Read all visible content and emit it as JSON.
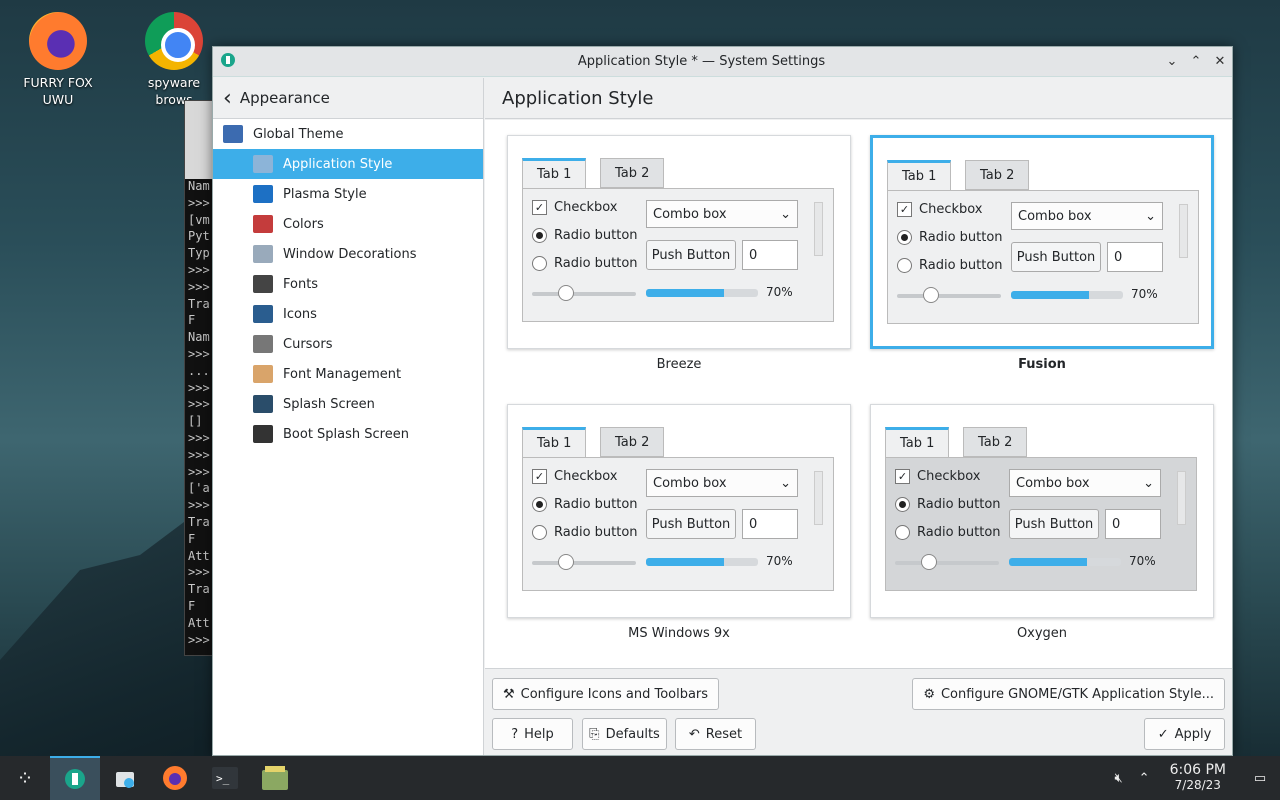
{
  "desktop": {
    "icons": [
      {
        "label": "FURRY FOX UWU"
      },
      {
        "label_line1": "spyware",
        "label_line2": "brows"
      }
    ]
  },
  "terminal": {
    "lines": [
      "Nam",
      ">>>",
      "[vm",
      "Pyt",
      "Typ",
      ">>>",
      ">>>",
      "Tra",
      "  F",
      "Nam",
      ">>>",
      "...",
      ">>>",
      ">>>",
      "[]",
      ">>>",
      ">>>",
      ">>>",
      "['a",
      ">>>",
      "Tra",
      "  F",
      "Att",
      ">>>",
      "Tra",
      "  F",
      "Att",
      ">>>"
    ]
  },
  "window": {
    "title": "Application Style * — System Settings"
  },
  "sidebar": {
    "header": "Appearance",
    "items": [
      {
        "label": "Global Theme",
        "color": "#3c6bb0"
      },
      {
        "label": "Application Style",
        "color": "#8cb4d8"
      },
      {
        "label": "Plasma Style",
        "color": "#1d70c4"
      },
      {
        "label": "Colors",
        "color": "#c43c3c"
      },
      {
        "label": "Window Decorations",
        "color": "#9ab"
      },
      {
        "label": "Fonts",
        "color": "#444"
      },
      {
        "label": "Icons",
        "color": "#2a5d8f"
      },
      {
        "label": "Cursors",
        "color": "#777"
      },
      {
        "label": "Font Management",
        "color": "#d9a46a"
      },
      {
        "label": "Splash Screen",
        "color": "#2a4d6a"
      },
      {
        "label": "Boot Splash Screen",
        "color": "#333"
      }
    ]
  },
  "main": {
    "title": "Application Style",
    "styles": [
      {
        "caption": "Breeze",
        "tab1": "Tab 1",
        "tab2": "Tab 2",
        "checkbox": "Checkbox",
        "radio1": "Radio button",
        "radio2": "Radio button",
        "combo": "Combo box",
        "push": "Push Button",
        "spin": "0",
        "progress_text": "70%",
        "progress": 0.7
      },
      {
        "caption": "Fusion",
        "tab1": "Tab 1",
        "tab2": "Tab 2",
        "checkbox": "Checkbox",
        "radio1": "Radio button",
        "radio2": "Radio button",
        "combo": "Combo box",
        "push": "Push Button",
        "spin": "0",
        "progress_text": "70%",
        "progress": 0.7
      },
      {
        "caption": "MS Windows 9x",
        "tab1": "Tab 1",
        "tab2": "Tab 2",
        "checkbox": "Checkbox",
        "radio1": "Radio button",
        "radio2": "Radio button",
        "combo": "Combo box",
        "push": "Push Button",
        "spin": "0",
        "progress_text": "70%",
        "progress": 0.7
      },
      {
        "caption": "Oxygen",
        "tab1": "Tab 1",
        "tab2": "Tab 2",
        "checkbox": "Checkbox",
        "radio1": "Radio button",
        "radio2": "Radio button",
        "combo": "Combo box",
        "push": "Push Button",
        "spin": "0",
        "progress_text": "70%",
        "progress": 0.7
      }
    ],
    "selected": "Fusion"
  },
  "footer": {
    "configure_icons": "Configure Icons and Toolbars",
    "configure_gtk": "Configure GNOME/GTK Application Style...",
    "help": "Help",
    "defaults": "Defaults",
    "reset": "Reset",
    "apply": "Apply"
  },
  "taskbar": {
    "time": "6:06 PM",
    "date": "7/28/23"
  },
  "colors": {
    "accent": "#3daee9"
  }
}
